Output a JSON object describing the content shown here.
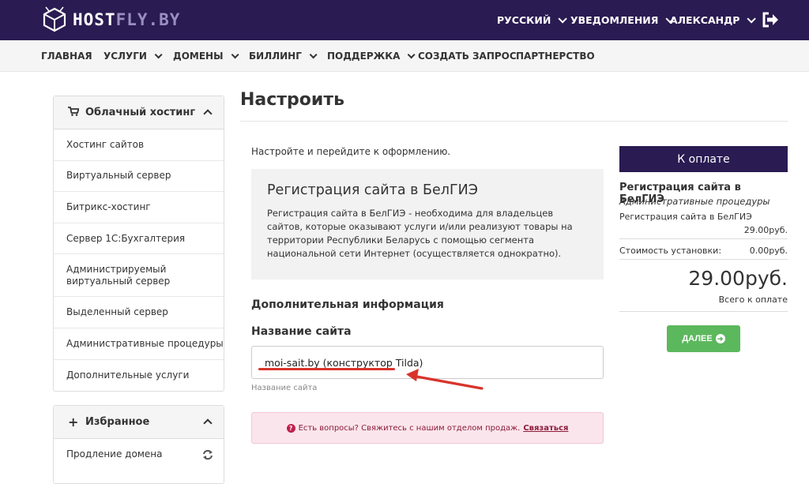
{
  "brand": {
    "logo_part1": "HOST",
    "logo_part2": "FLY.BY"
  },
  "topnav": {
    "language": "РУССКИЙ",
    "notifications": "УВЕДОМЛЕНИЯ",
    "user": "АЛЕКСАНДР"
  },
  "mainnav": {
    "home": "ГЛАВНАЯ",
    "services": "УСЛУГИ",
    "domains": "ДОМЕНЫ",
    "billing": "БИЛЛИНГ",
    "support": "ПОДДЕРЖКА",
    "request": "СОЗДАТЬ ЗАПРОС",
    "partners": "ПАРТНЕРСТВО"
  },
  "sidebar": {
    "cloud_title": "Облачный хостинг",
    "cloud_items": [
      "Хостинг сайтов",
      "Виртуальный сервер",
      "Битрикс-хостинг",
      "Сервер 1С:Бухгалтерия",
      "Администрируемый виртуальный сервер",
      "Выделенный сервер",
      "Административные процедуры",
      "Дополнительные услуги"
    ],
    "fav_title": "Избранное",
    "fav_items": [
      "Продление домена"
    ]
  },
  "main": {
    "title": "Настроить",
    "intro": "Настройте и перейдите к оформлению.",
    "product_name": "Регистрация сайта в БелГИЭ",
    "product_desc": "Регистрация сайта в БелГИЭ - необходима для владельцев сайтов, которые оказывают услуги и/или реализуют товары на территории Республики Беларусь с помощью сегмента национальной сети Интернет (осуществляется однократно).",
    "additional_info": "Дополнительная информация",
    "site_name_label": "Название сайта",
    "site_name_value": "moi-sait.by (конструктор Tilda)",
    "site_name_help": "Название сайта",
    "alert_text": "Есть вопросы? Свяжитесь с нашим отделом продаж.",
    "alert_link": "Связаться"
  },
  "summary": {
    "header": "К оплате",
    "product": "Регистрация сайта в БелГИЭ",
    "group": "Административные процедуры",
    "line_name": "Регистрация сайта в БелГИЭ",
    "line_price": "29.00руб.",
    "setup_label": "Стоимость установки:",
    "setup_value": "0.00руб.",
    "total": "29.00руб.",
    "total_label": "Всего к оплате",
    "next_label": "ДАЛЕЕ"
  },
  "colors": {
    "primary": "#2a1b52",
    "accent_green": "#5cb85c",
    "annotation_red": "#d9342b"
  }
}
